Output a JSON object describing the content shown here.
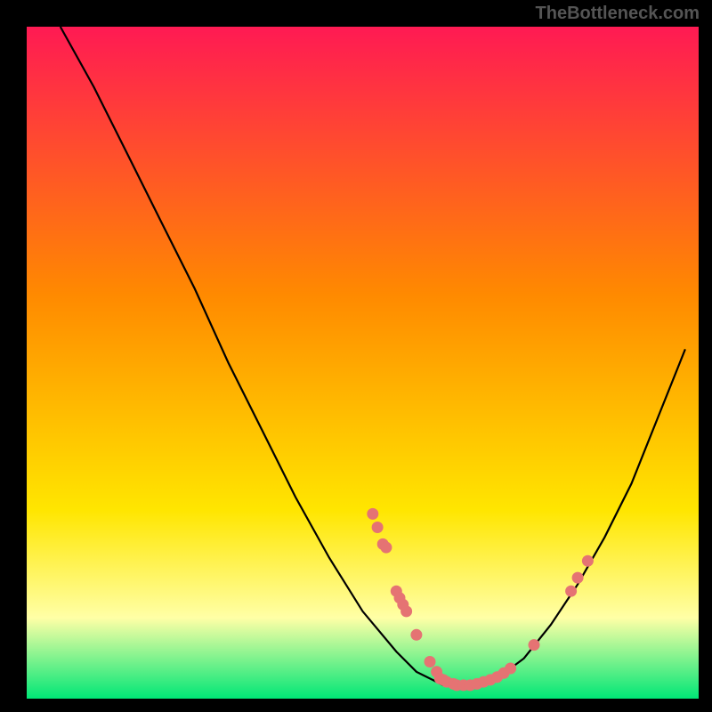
{
  "watermark": "TheBottleneck.com",
  "chart_data": {
    "type": "line",
    "title": "",
    "xlabel": "",
    "ylabel": "",
    "xlim": [
      0,
      100
    ],
    "ylim": [
      0,
      100
    ],
    "background_gradient": {
      "top": "#ff1a53",
      "mid1": "#ff8a00",
      "mid2": "#ffe600",
      "band": "#ffffa6",
      "bottom": "#00e676"
    },
    "curve": [
      {
        "x": 5,
        "y": 100
      },
      {
        "x": 10,
        "y": 91
      },
      {
        "x": 15,
        "y": 81
      },
      {
        "x": 20,
        "y": 71
      },
      {
        "x": 25,
        "y": 61
      },
      {
        "x": 30,
        "y": 50
      },
      {
        "x": 35,
        "y": 40
      },
      {
        "x": 40,
        "y": 30
      },
      {
        "x": 45,
        "y": 21
      },
      {
        "x": 50,
        "y": 13
      },
      {
        "x": 55,
        "y": 7
      },
      {
        "x": 58,
        "y": 4
      },
      {
        "x": 62,
        "y": 2
      },
      {
        "x": 66,
        "y": 2
      },
      {
        "x": 70,
        "y": 3
      },
      {
        "x": 74,
        "y": 6
      },
      {
        "x": 78,
        "y": 11
      },
      {
        "x": 82,
        "y": 17
      },
      {
        "x": 86,
        "y": 24
      },
      {
        "x": 90,
        "y": 32
      },
      {
        "x": 94,
        "y": 42
      },
      {
        "x": 98,
        "y": 52
      }
    ],
    "dots": [
      {
        "x": 51.5,
        "y": 27.5
      },
      {
        "x": 52.2,
        "y": 25.5
      },
      {
        "x": 53.0,
        "y": 23.0
      },
      {
        "x": 53.5,
        "y": 22.5
      },
      {
        "x": 55.0,
        "y": 16.0
      },
      {
        "x": 55.5,
        "y": 15.0
      },
      {
        "x": 56.0,
        "y": 14.0
      },
      {
        "x": 56.5,
        "y": 13.0
      },
      {
        "x": 58.0,
        "y": 9.5
      },
      {
        "x": 60.0,
        "y": 5.5
      },
      {
        "x": 61.0,
        "y": 4.0
      },
      {
        "x": 61.5,
        "y": 3.0
      },
      {
        "x": 62.0,
        "y": 2.8
      },
      {
        "x": 62.5,
        "y": 2.5
      },
      {
        "x": 63.5,
        "y": 2.2
      },
      {
        "x": 64.0,
        "y": 2.0
      },
      {
        "x": 65.0,
        "y": 2.0
      },
      {
        "x": 66.0,
        "y": 2.0
      },
      {
        "x": 67.0,
        "y": 2.2
      },
      {
        "x": 68.0,
        "y": 2.5
      },
      {
        "x": 69.0,
        "y": 2.8
      },
      {
        "x": 70.0,
        "y": 3.2
      },
      {
        "x": 71.0,
        "y": 3.8
      },
      {
        "x": 72.0,
        "y": 4.5
      },
      {
        "x": 75.5,
        "y": 8.0
      },
      {
        "x": 81.0,
        "y": 16.0
      },
      {
        "x": 82.0,
        "y": 18.0
      },
      {
        "x": 83.5,
        "y": 20.5
      }
    ],
    "dot_color": "#e57373",
    "plot_border_color": "#000000"
  }
}
